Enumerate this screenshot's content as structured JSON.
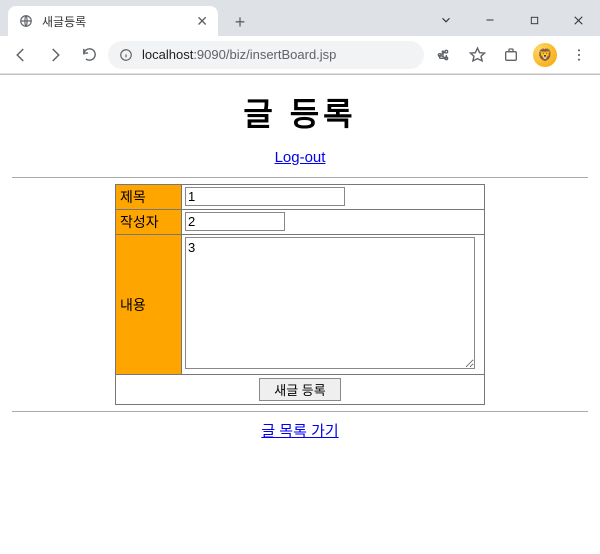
{
  "window": {
    "tab_title": "새글등록",
    "url_host": "localhost",
    "url_port": ":9090",
    "url_path": "/biz/insertBoard.jsp"
  },
  "page": {
    "heading": "글 등록",
    "logout_label": "Log-out",
    "list_link_label": "글 목록 가기"
  },
  "form": {
    "labels": {
      "title": "제목",
      "writer": "작성자",
      "content": "내용"
    },
    "values": {
      "title": "1",
      "writer": "2",
      "content": "3"
    },
    "submit_label": "새글 등록"
  }
}
